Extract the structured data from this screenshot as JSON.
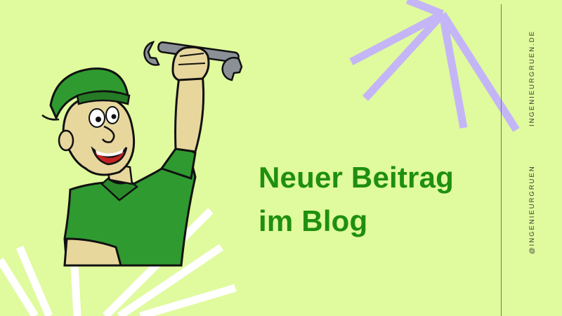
{
  "headline": {
    "line1": "Neuer Beitrag",
    "line2": "im Blog"
  },
  "sidebar": {
    "website": "INGENIEURGRUEN.DE",
    "handle": "@INGENIEURGRUEN"
  },
  "colors": {
    "background": "#e0fa9e",
    "headline": "#1f8f0f",
    "burst_top": "#c4b5f7",
    "burst_bottom": "#ffffff",
    "divider": "#6f7f5e"
  },
  "illustration": "mechanic-with-wrench"
}
